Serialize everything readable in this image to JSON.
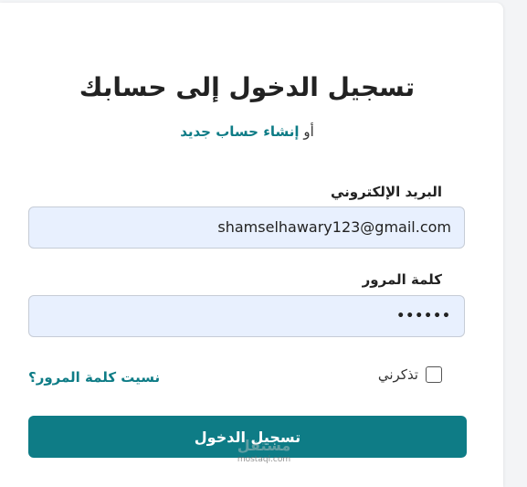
{
  "login": {
    "title": "تسجيل الدخول إلى حسابك",
    "or_text": "أو",
    "create_account_link": "إنشاء حساب جديد",
    "email_label": "البريد الإلكتروني",
    "email_value": "shamselhawary123@gmail.com",
    "password_label": "كلمة المرور",
    "password_value": "••••••",
    "remember_label": "تذكرني",
    "remember_checked": false,
    "forgot_link": "نسيت كلمة المرور؟",
    "submit_label": "تسجيل الدخول"
  },
  "watermark": {
    "arabic": "مستقل",
    "latin": "mostaql.com"
  },
  "colors": {
    "accent": "#0e7c86",
    "input_bg": "#e8f0fe",
    "page_bg": "#f3f4f6",
    "card_bg": "#ffffff"
  },
  "icons": {
    "remember_checkbox": "checkbox-unchecked-icon"
  }
}
